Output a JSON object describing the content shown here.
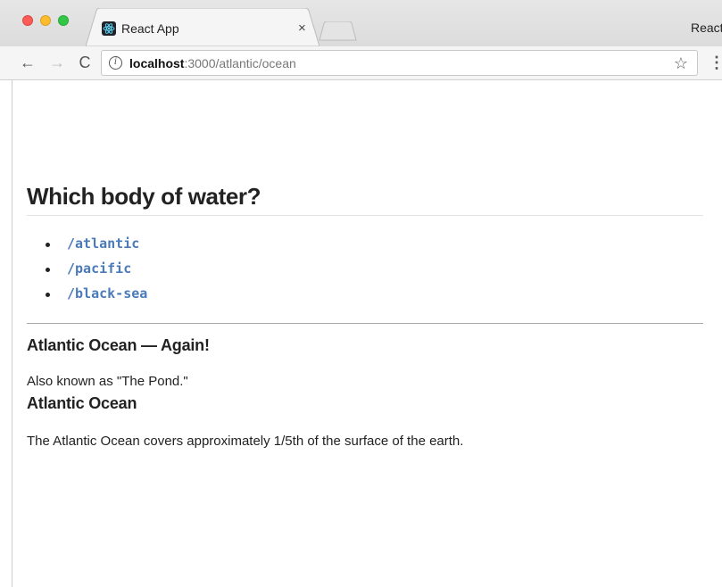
{
  "window": {
    "tab_title": "React App",
    "tab_close": "×",
    "profile_label": "React"
  },
  "toolbar": {
    "back_icon": "←",
    "forward_icon": "→",
    "reload_icon": "C",
    "url_host": "localhost",
    "url_rest": ":3000/atlantic/ocean",
    "star_icon": "☆",
    "menu_icon": "⋮"
  },
  "page": {
    "title": "Which body of water?",
    "links": [
      {
        "label": "/atlantic"
      },
      {
        "label": "/pacific"
      },
      {
        "label": "/black-sea"
      }
    ],
    "heading_again": "Atlantic Ocean — Again!",
    "aka": "Also known as \"The Pond.\"",
    "heading_ocean": "Atlantic Ocean",
    "description": "The Atlantic Ocean covers approximately 1/5th of the surface of the earth."
  },
  "colors": {
    "link": "#4a7ab8",
    "text": "#222222"
  }
}
